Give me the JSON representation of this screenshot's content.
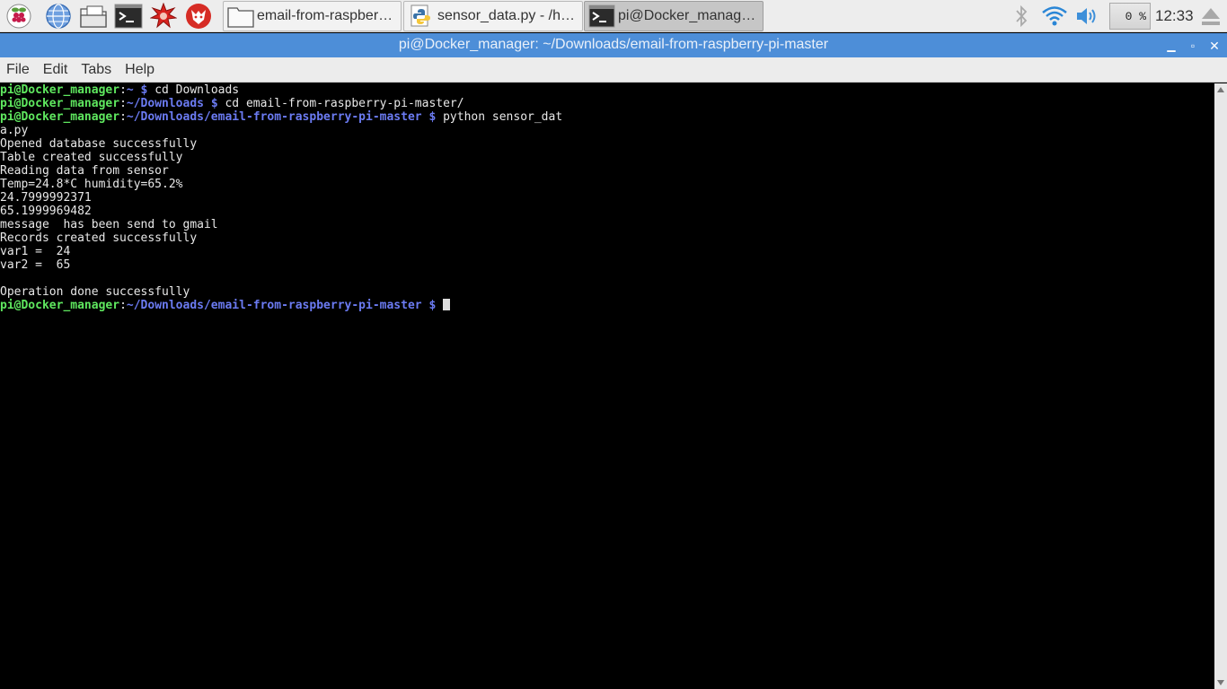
{
  "panel": {
    "launchers": [
      {
        "icon": "raspberry-menu-icon",
        "name": "raspberry-menu-button"
      },
      {
        "icon": "web-browser-icon",
        "name": "browser-launcher"
      },
      {
        "icon": "file-manager-icon",
        "name": "file-manager-launcher"
      },
      {
        "icon": "terminal-icon",
        "name": "terminal-launcher"
      },
      {
        "icon": "mathematica-icon",
        "name": "mathematica-launcher"
      },
      {
        "icon": "wolfram-icon",
        "name": "wolfram-launcher"
      }
    ],
    "tasks": [
      {
        "label": "email-from-raspberry...",
        "icon": "folder-icon",
        "active": false
      },
      {
        "label": "sensor_data.py - /ho...",
        "icon": "python-icon",
        "active": false
      },
      {
        "label": "pi@Docker_manager...",
        "icon": "terminal-icon",
        "active": true
      }
    ],
    "cpu_usage": "0 %",
    "clock": "12:33"
  },
  "window": {
    "title": "pi@Docker_manager: ~/Downloads/email-from-raspberry-pi-master",
    "buttons": {
      "minimize": "▁",
      "maximize": "▫",
      "close": "✕"
    }
  },
  "menubar": {
    "items": [
      "File",
      "Edit",
      "Tabs",
      "Help"
    ]
  },
  "terminal": {
    "user_host": "pi@Docker_manager",
    "lines": [
      {
        "path": "~",
        "cmd": "cd Downloads"
      },
      {
        "path": "~/Downloads",
        "cmd": "cd email-from-raspberry-pi-master/"
      },
      {
        "path": "~/Downloads/email-from-raspberry-pi-master",
        "cmd": "python sensor_dat"
      }
    ],
    "output": [
      "a.py",
      "Opened database successfully",
      "Table created successfully",
      "Reading data from sensor",
      "Temp=24.8*C humidity=65.2%",
      "24.7999992371",
      "65.1999969482",
      "message  has been send to gmail",
      "Records created successfully",
      "var1 =  24",
      "var2 =  65",
      "",
      "Operation done successfully"
    ],
    "final_prompt": {
      "path": "~/Downloads/email-from-raspberry-pi-master"
    },
    "prompt_sep": ":",
    "prompt_dollar": "$"
  }
}
